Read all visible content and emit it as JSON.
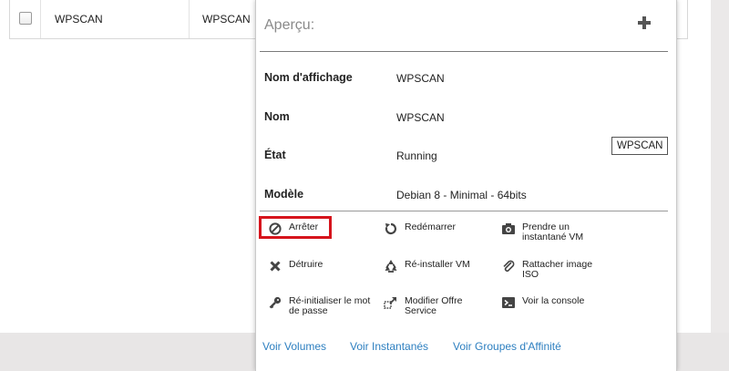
{
  "row": {
    "col1": "WPSCAN",
    "col2": "WPSCAN"
  },
  "panel": {
    "title": "Aperçu:",
    "fields": [
      {
        "label": "Nom d'affichage",
        "value": "WPSCAN"
      },
      {
        "label": "Nom",
        "value": "WPSCAN"
      },
      {
        "label": "État",
        "value": "Running"
      },
      {
        "label": "Modèle",
        "value": "Debian 8 - Minimal - 64bits"
      }
    ],
    "name_tag": "WPSCAN",
    "actions": {
      "stop": "Arrêter",
      "restart": "Redémarrer",
      "snapshot": "Prendre un instantané VM",
      "destroy": "Détruire",
      "reinstall": "Ré-installer VM",
      "attach_iso": "Rattacher image ISO",
      "reset_password": "Ré-initialiser le mot de passe",
      "change_offer": "Modifier Offre Service",
      "console": "Voir la console"
    },
    "links": {
      "volumes": "Voir Volumes",
      "snapshots": "Voir Instantanés",
      "affinity": "Voir Groupes d'Affinité"
    }
  },
  "colors": {
    "link": "#2d7fc0",
    "highlight": "#d6141c",
    "title": "#8a8a8a"
  },
  "icons": {
    "stop": "stop-circle-icon",
    "restart": "restart-icon",
    "snapshot": "camera-icon",
    "destroy": "x-icon",
    "reinstall": "recycle-icon",
    "attach_iso": "paperclip-icon",
    "reset_password": "key-icon",
    "change_offer": "resize-icon",
    "console": "terminal-icon",
    "add": "plus-icon"
  }
}
